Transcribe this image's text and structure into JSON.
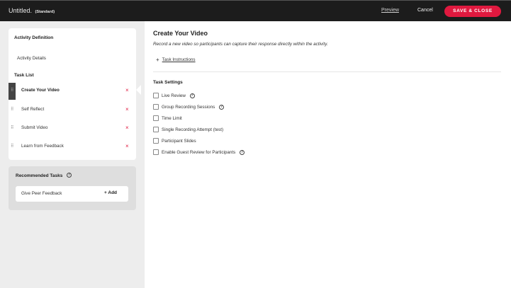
{
  "topbar": {
    "title": "Untitled.",
    "subtitle": "(Standard)",
    "preview": "Preview",
    "cancel": "Cancel",
    "save_close": "SAVE & CLOSE"
  },
  "sidebar": {
    "activity_definition": "Activity Definition",
    "activity_details": "Activity Details",
    "task_list_heading": "Task List",
    "tasks": [
      {
        "label": "Create Your Video",
        "active": true
      },
      {
        "label": "Self Reflect",
        "active": false
      },
      {
        "label": "Submit Video",
        "active": false
      },
      {
        "label": "Learn from Feedback",
        "active": false
      }
    ],
    "remove_glyph": "×",
    "recommended": {
      "heading": "Recommended Tasks",
      "item": "Give Peer Feedback",
      "add_label": "Add"
    }
  },
  "main": {
    "title": "Create Your Video",
    "description": "Record a new video so participants can capture their response directly within the activity.",
    "instructions": "Task Instructions",
    "settings_heading": "Task Settings",
    "settings": [
      {
        "label": "Live Review",
        "help": true
      },
      {
        "label": "Group Recording Sessions",
        "help": true
      },
      {
        "label": "Time Limit",
        "help": false
      },
      {
        "label": "Single Recording Attempt (test)",
        "help": false
      },
      {
        "label": "Participant Slides",
        "help": false
      },
      {
        "label": "Enable Guest Review for Participants",
        "help": true
      }
    ]
  },
  "colors": {
    "accent": "#e0193f",
    "topbar": "#1c1c1c",
    "sidebar_bg": "#ededed"
  },
  "icons": {
    "help": "question-circle-icon",
    "drag": "drag-handle-icon",
    "remove": "close-icon",
    "add": "plus-icon"
  }
}
